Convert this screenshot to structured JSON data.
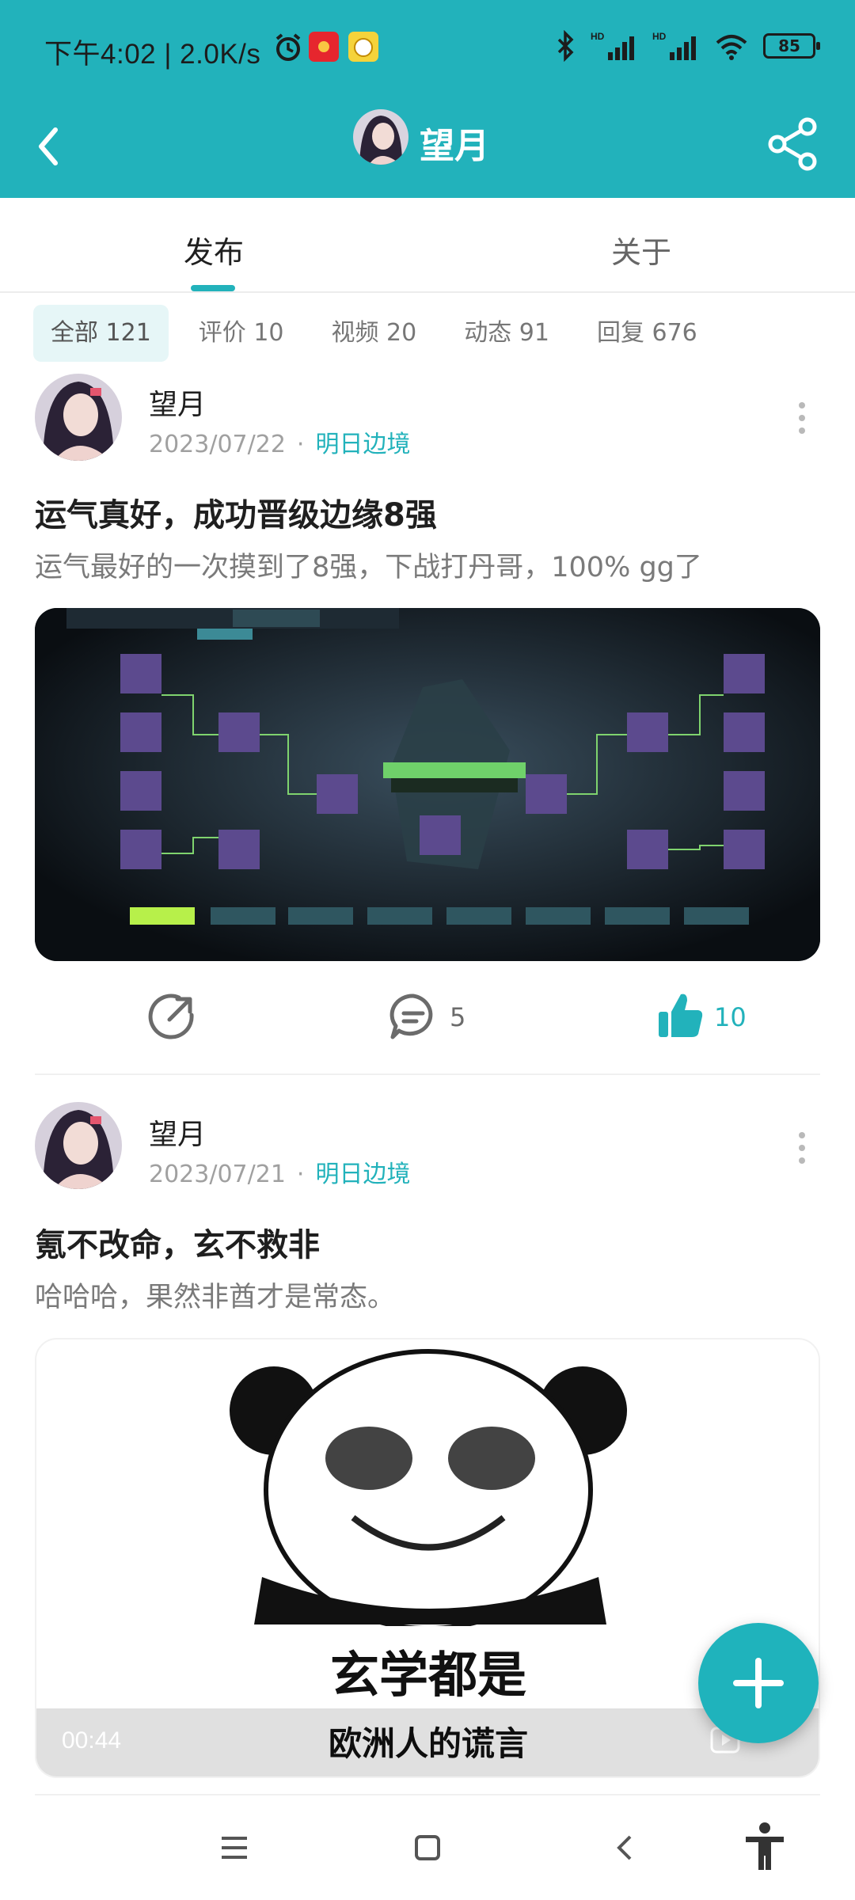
{
  "status_bar": {
    "time_speed": "下午4:02 | 2.0K/s",
    "battery": "85"
  },
  "header": {
    "title": "望月"
  },
  "tabs": [
    {
      "label": "发布",
      "active": true
    },
    {
      "label": "关于",
      "active": false
    }
  ],
  "filters": [
    {
      "label": "全部 121",
      "active": true
    },
    {
      "label": "评价 10",
      "active": false
    },
    {
      "label": "视频 20",
      "active": false
    },
    {
      "label": "动态 91",
      "active": false
    },
    {
      "label": "回复 676",
      "active": false
    }
  ],
  "posts": [
    {
      "author": "望月",
      "date": "2023/07/22",
      "dot": "·",
      "category": "明日边境",
      "title": "运气真好，成功晋级边缘8强",
      "description": "运气最好的一次摸到了8强，下战打丹哥，100% gg了",
      "comments": "5",
      "likes": "10",
      "liked": true
    },
    {
      "author": "望月",
      "date": "2023/07/21",
      "dot": "·",
      "category": "明日边境",
      "title": "氪不改命，玄不救非",
      "description": "哈哈哈，果然非酋才是常态。",
      "video_time": "00:44",
      "meme_line1": "玄学都是",
      "meme_line2": "欧洲人的谎言"
    }
  ],
  "colors": {
    "accent": "#22b2bb",
    "chip_active_bg": "#e6f6f7"
  }
}
